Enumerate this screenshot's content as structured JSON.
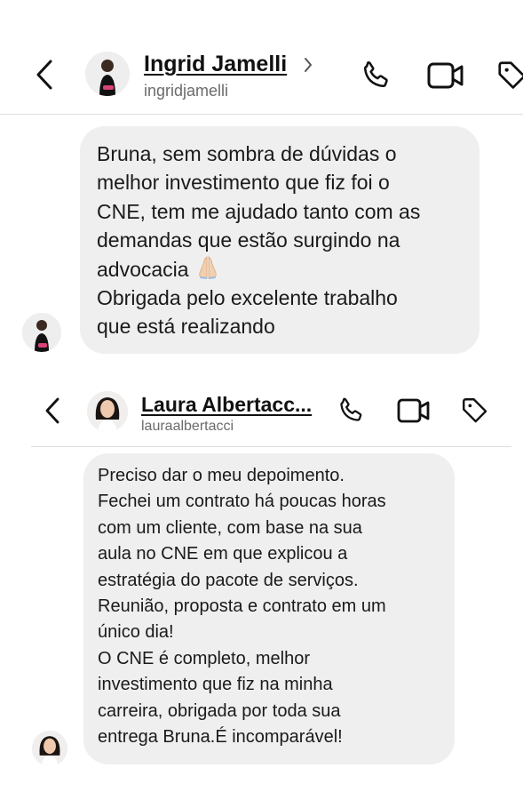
{
  "chat1": {
    "contact_name": "Ingrid Jamelli",
    "contact_handle": "ingridjamelli",
    "message_lines": [
      "Bruna, sem sombra de dúvidas o",
      "melhor investimento que fiz foi o",
      "CNE, tem me ajudado tanto com as",
      "demandas que estão surgindo na",
      "advocacia",
      "Obrigada pelo excelente trabalho",
      "que está realizando"
    ]
  },
  "chat2": {
    "contact_name": "Laura Albertacc...",
    "contact_handle": "lauraalbertacci",
    "message_lines": [
      "Preciso dar o meu depoimento.",
      "Fechei um contrato há poucas horas",
      "com um cliente, com base na sua",
      "aula no CNE em que explicou a",
      "estratégia do pacote de serviços.",
      "Reunião, proposta e contrato em um",
      "único dia!",
      "O CNE é completo, melhor",
      "investimento que fiz na minha",
      "carreira, obrigada por toda sua",
      "entrega Bruna.É incomparável!"
    ]
  },
  "icons": {
    "back": "chevron-left-icon",
    "profile_arrow": "chevron-right-icon",
    "call": "phone-icon",
    "video": "video-camera-icon",
    "tag": "tag-icon",
    "reaction": "folded-hands-emoji"
  },
  "colors": {
    "bubble": "#efefef",
    "handle": "#6b6b6b",
    "divider": "#dedede"
  }
}
